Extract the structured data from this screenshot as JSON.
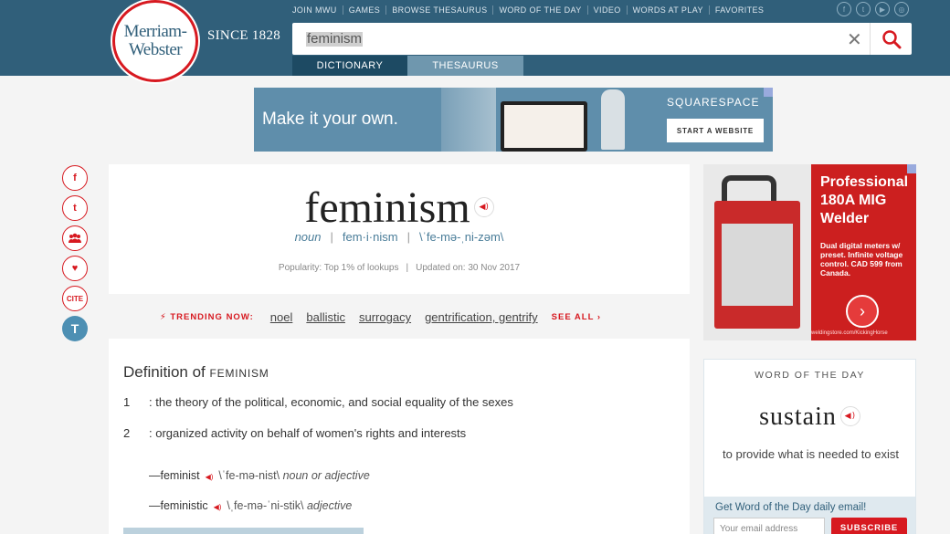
{
  "header": {
    "logo": [
      "Merriam-",
      "Webster"
    ],
    "since": "SINCE 1828",
    "nav": [
      "JOIN MWU",
      "GAMES",
      "BROWSE THESAURUS",
      "WORD OF THE DAY",
      "VIDEO",
      "WORDS AT PLAY",
      "FAVORITES"
    ],
    "social_icons": [
      "facebook-icon",
      "twitter-icon",
      "youtube-icon",
      "instagram-icon"
    ],
    "search": {
      "value": "feminism"
    },
    "tabs": [
      "DICTIONARY",
      "THESAURUS"
    ]
  },
  "banner_ad": {
    "headline": "Make it your own.",
    "brand": "SQUARESPACE",
    "cta": "START A WEBSITE"
  },
  "share": [
    "f",
    "t",
    "group",
    "♥",
    "CITE",
    "T"
  ],
  "entry": {
    "headword": "feminism",
    "function_label": "noun",
    "syllables": "fem·i·nism",
    "pronunciation": "\\ˈfe-mə-ˌni-zəm\\",
    "popularity": "Popularity: Top 1% of lookups",
    "updated": "Updated on: 30 Nov 2017"
  },
  "trending": {
    "label": "TRENDING NOW:",
    "links": [
      "noel",
      "ballistic",
      "surrogacy",
      "gentrification, gentrify"
    ],
    "see_all": "SEE ALL ›"
  },
  "definition": {
    "title_prefix": "Definition of",
    "title_word": "FEMINISM",
    "senses": [
      {
        "num": "1",
        "text": ": the theory of the political, economic, and social equality of the sexes"
      },
      {
        "num": "2",
        "text": ": organized activity on behalf of women's rights and interests"
      }
    ],
    "run_ons": [
      {
        "word": "—feminist",
        "pr": "\\ˈfe-mə-nist\\",
        "fl": "noun or adjective"
      },
      {
        "word": "—feministic",
        "pr": "\\ˌfe-mə-ˈni-stik\\",
        "fl": "adjective"
      }
    ]
  },
  "side_ad": {
    "title": "Professional 180A MIG Welder",
    "desc": "Dual digital meters w/ preset. Infinite voltage control. CAD 599 from Canada.",
    "url": "weldingstore.com/KickingHorse"
  },
  "word_of_day": {
    "label": "WORD OF THE DAY",
    "word": "sustain",
    "meaning": "to provide what is needed to exist",
    "signup_prompt": "Get Word of the Day daily email!",
    "email_placeholder": "Your email address",
    "subscribe": "SUBSCRIBE"
  }
}
